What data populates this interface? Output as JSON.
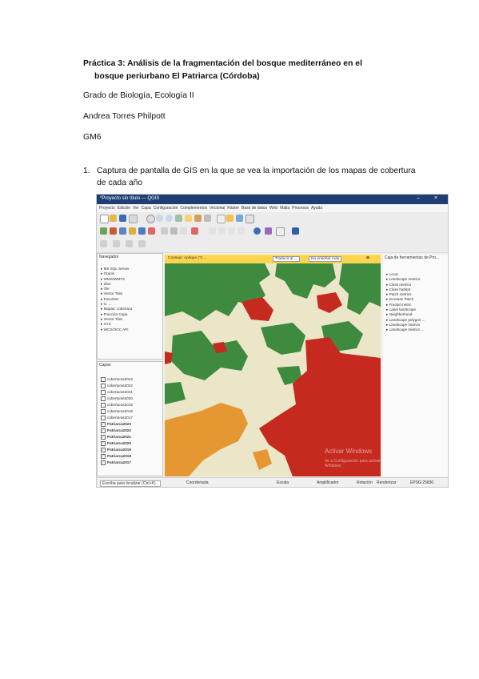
{
  "document": {
    "title_line1": "Práctica 3: Análisis de la fragmentación del bosque mediterráneo en el",
    "title_line2": "bosque periurbano El Patriarca (Córdoba)",
    "course": "Grado de Biología, Ecología II",
    "author": "Andrea Torres Philpott",
    "group": "GM6",
    "item_number": "1.",
    "item_text": "Captura de pantalla de GIS en la que se vea la importación de los mapas de cobertura de cada año"
  },
  "screenshot": {
    "window_title": "*Proyecto sin título — QGIS",
    "menu": [
      "Proyecto",
      "Edición",
      "Ver",
      "Capa",
      "Configuración",
      "Complementos",
      "Vectorial",
      "Ráster",
      "Base de datos",
      "Web",
      "Malla",
      "Procesos",
      "Ayuda"
    ],
    "browser_panel": {
      "title": "Navegador",
      "items": [
        "MS SQL Server",
        "Oracle",
        "WMS/WMTS",
        "Zfus",
        "Tile",
        "Vector Tiles",
        "Favorites",
        "G: ...",
        "Mapas: cobertura",
        "Fracción Capa",
        "Vector Tiles",
        "XYZ",
        "WCS/OGC API"
      ]
    },
    "layers_panel": {
      "title": "Capas",
      "layers": [
        {
          "name": "coberturas2022",
          "checked": false,
          "bold": false
        },
        {
          "name": "coberturas2022",
          "checked": false,
          "bold": false
        },
        {
          "name": "coberturas2021",
          "checked": false,
          "bold": false
        },
        {
          "name": "coberturas2020",
          "checked": false,
          "bold": false
        },
        {
          "name": "coberturas2019",
          "checked": false,
          "bold": false
        },
        {
          "name": "coberturas2018",
          "checked": false,
          "bold": false
        },
        {
          "name": "coberturas2017",
          "checked": false,
          "bold": false
        },
        {
          "name": "Patriarca2023",
          "checked": true,
          "bold": true
        },
        {
          "name": "Patriarca2022",
          "checked": true,
          "bold": true
        },
        {
          "name": "Patriarca2021",
          "checked": true,
          "bold": true
        },
        {
          "name": "Patriarca2020",
          "checked": true,
          "bold": true
        },
        {
          "name": "Patriarca2019",
          "checked": true,
          "bold": true
        },
        {
          "name": "Patriarca2018",
          "checked": true,
          "bold": true
        },
        {
          "name": "Patriarca2017",
          "checked": true,
          "bold": true
        }
      ]
    },
    "message_bar": {
      "text": "Consejo: Aplique (?) ...",
      "button1": "Traducir al ...",
      "button2": "No enseñar más"
    },
    "right_panel": {
      "title": "Caja de herramientas de Pro...",
      "items": [
        "Local",
        "Landscape metrics",
        "Class metrics",
        "Class habitat",
        "Patch metrics",
        "Increase Patch",
        "Fractal metric",
        "Label landscape",
        "Neighborhood",
        "Landscape polygon ...",
        "Landscape metrics",
        "Landscape metrics ..."
      ]
    },
    "status": {
      "search_placeholder": "Escriba para localizar (Ctrl+K)",
      "coordinate_label": "Coordenada",
      "scale_label": "Escala",
      "magnifier_label": "Amplificador",
      "rotation_label": "Rotación",
      "render_label": "Renderizar",
      "crs_label": "EPSG:25830"
    },
    "watermark_line1": "Activar Windows",
    "watermark_line2": "Ve a Configuración para activar Windows.",
    "map_colors": {
      "bosque": "#3e8a3e",
      "matorral": "#ebe6c8",
      "urbano": "#c62a1f",
      "agricola": "#e59732"
    }
  }
}
